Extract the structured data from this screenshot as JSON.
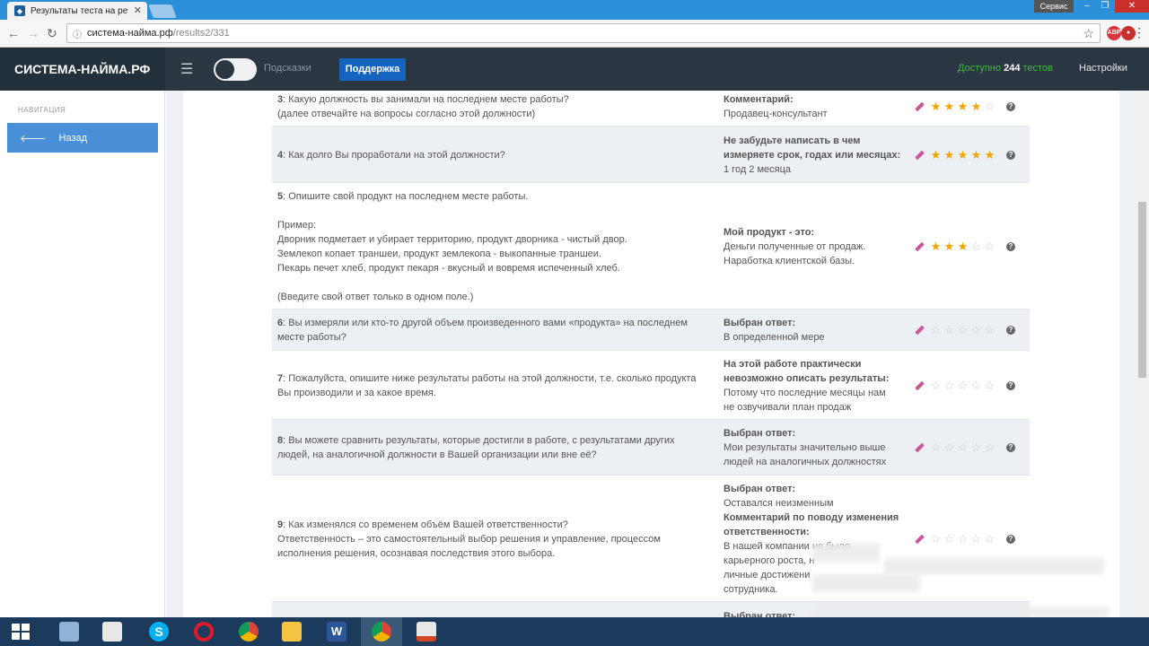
{
  "browser": {
    "tab_title": "Результаты теста на ре",
    "url_host": "система-найма.рф",
    "url_path": "/results2/331",
    "servis_label": "Сервис"
  },
  "header": {
    "logo": "СИСТЕМА-НАЙМА.РФ",
    "hints_label": "Подсказки",
    "support_label": "Поддержка",
    "available_prefix": "Доступно",
    "available_count": "244",
    "available_suffix": "тестов",
    "settings_label": "Настройки"
  },
  "sidebar": {
    "heading": "НАВИГАЦИЯ",
    "back_label": "Назад"
  },
  "rows": [
    {
      "num": "3",
      "question": [
        "Какую должность вы занимали на последнем месте работы?",
        "(далее отвечайте на вопросы согласно этой должности)"
      ],
      "answer_label": [
        "Комментарий:"
      ],
      "answer_text": [
        "Продавец-консультант"
      ],
      "rating": 4
    },
    {
      "num": "4",
      "question": [
        "Как долго Вы проработали на этой должности?"
      ],
      "answer_label": [
        "Не забудьте написать в чем",
        "измеряете срок, годах или месяцах:"
      ],
      "answer_text": [
        "1 год 2 месяца"
      ],
      "rating": 5
    },
    {
      "num": "5",
      "question": [
        "Опишите свой продукт на последнем месте работы.",
        "",
        "Пример:",
        "Дворник подметает и убирает территорию, продукт дворника - чистый двор.",
        "Землекоп копает траншеи, продукт землекопа - выкопанные траншеи.",
        "Пекарь печет хлеб, продукт пекаря - вкусный и вовремя испеченный хлеб.",
        "",
        "(Введите свой ответ только в одном поле.)"
      ],
      "answer_label": [
        "Мой продукт - это:"
      ],
      "answer_text": [
        "Деньги полученные от продаж.",
        "Наработка клиентской базы."
      ],
      "rating": 3
    },
    {
      "num": "6",
      "question": [
        "Вы измеряли или кто-то другой объем произведенного вами «продукта» на последнем",
        "месте работы?"
      ],
      "answer_label": [
        "Выбран ответ:"
      ],
      "answer_text": [
        "В определенной мере"
      ],
      "rating": 0
    },
    {
      "num": "7",
      "question": [
        "Пожалуйста, опишите ниже результаты работы на этой должности, т.е. сколько продукта",
        "Вы производили и за какое время."
      ],
      "answer_label": [
        "На этой работе практически",
        "невозможно описать результаты:"
      ],
      "answer_text": [
        "Потому что последние месяцы нам",
        "не озвучивали план продаж"
      ],
      "rating": 0
    },
    {
      "num": "8",
      "question": [
        "Вы можете сравнить результаты, которые достигли в работе, с результатами других",
        "людей, на аналогичной должности в Вашей организации или вне её?"
      ],
      "answer_label": [
        "Выбран ответ:"
      ],
      "answer_text": [
        "Мои результаты значительно выше",
        "людей на аналогичных должностях"
      ],
      "rating": 0
    },
    {
      "num": "9",
      "question": [
        "Как изменялся со временем объём Вашей ответственности?",
        "Ответственность – это самостоятельный выбор решения и управление, процессом",
        "исполнения решения, осознавая последствия этого выбора."
      ],
      "answer_blocks": [
        {
          "label": "Выбран ответ:",
          "text": "Оставался неизменным"
        },
        {
          "label": "Комментарий по поводу изменения",
          "text": ""
        },
        {
          "label": "ответственности:",
          "text": ""
        }
      ],
      "answer_text": [
        "В нашей компании не было",
        "карьерного роста, н",
        "личные достижени",
        "сотрудника."
      ],
      "rating": 0
    },
    {
      "num": "",
      "question": [],
      "answer_label": [
        "Выбран ответ:"
      ],
      "answer_text": [],
      "rating": -1
    }
  ],
  "taskbar": {
    "icons": [
      "windows-start",
      "calculator",
      "notepad-pen",
      "skype",
      "opera",
      "chrome",
      "file-explorer",
      "word",
      "chrome-active",
      "presentation"
    ]
  },
  "colors": {
    "header_bg": "#2b3643",
    "accent_blue": "#1565c0",
    "sidebar_back": "#4a90d9",
    "star_on": "#f0a500",
    "available_green": "#3bbd37"
  }
}
